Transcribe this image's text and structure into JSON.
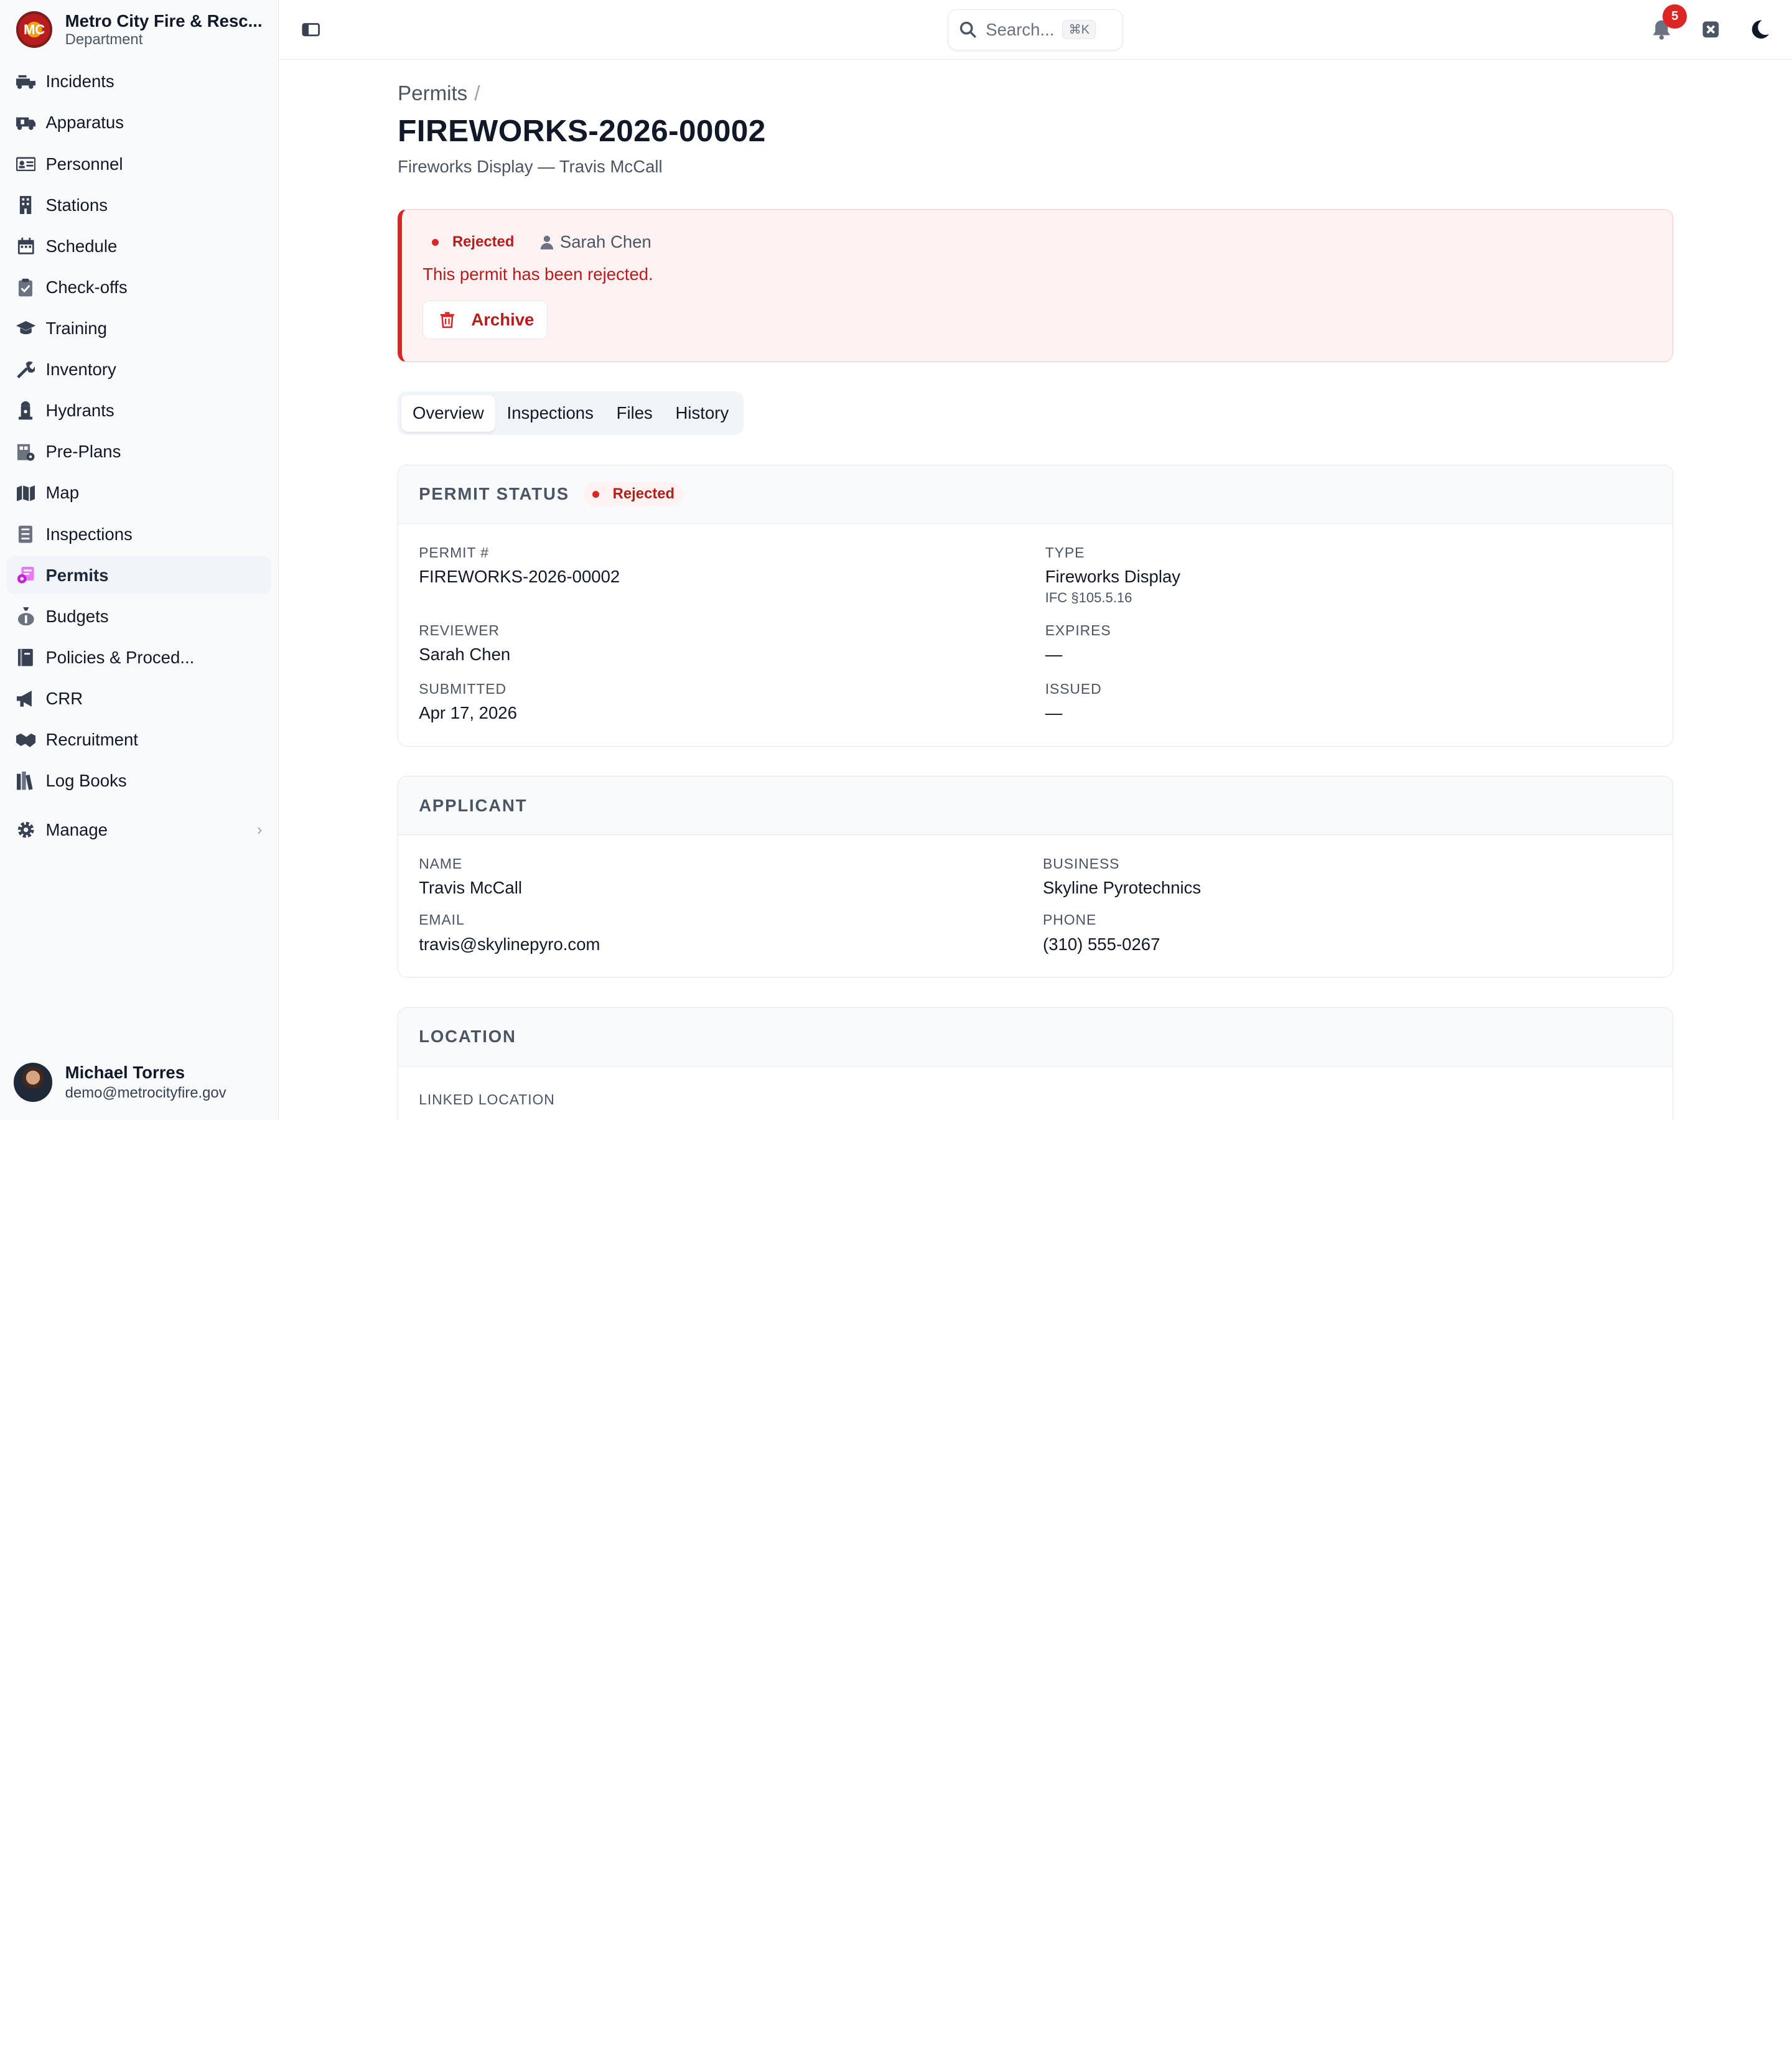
{
  "brand": {
    "name": "Metro City Fire & Resc...",
    "sub": "Department",
    "logo_text": "MC"
  },
  "nav": [
    {
      "label": "Incidents",
      "icon": "fire-truck-icon"
    },
    {
      "label": "Apparatus",
      "icon": "ambulance-icon"
    },
    {
      "label": "Personnel",
      "icon": "id-card-icon"
    },
    {
      "label": "Stations",
      "icon": "building-icon"
    },
    {
      "label": "Schedule",
      "icon": "calendar-icon"
    },
    {
      "label": "Check-offs",
      "icon": "clipboard-icon"
    },
    {
      "label": "Training",
      "icon": "graduation-cap-icon"
    },
    {
      "label": "Inventory",
      "icon": "wrench-icon"
    },
    {
      "label": "Hydrants",
      "icon": "hydrant-icon"
    },
    {
      "label": "Pre-Plans",
      "icon": "blueprint-icon"
    },
    {
      "label": "Map",
      "icon": "map-icon"
    },
    {
      "label": "Inspections",
      "icon": "checklist-icon"
    },
    {
      "label": "Permits",
      "icon": "permit-icon",
      "active": true
    },
    {
      "label": "Budgets",
      "icon": "money-bag-icon"
    },
    {
      "label": "Policies & Proced...",
      "icon": "book-icon"
    },
    {
      "label": "CRR",
      "icon": "megaphone-icon"
    },
    {
      "label": "Recruitment",
      "icon": "handshake-icon"
    },
    {
      "label": "Log Books",
      "icon": "books-icon"
    },
    {
      "label": "Manage",
      "icon": "gear-icon",
      "has_chevron": true
    }
  ],
  "user": {
    "name": "Michael Torres",
    "email": "demo@metrocityfire.gov"
  },
  "topbar": {
    "search_placeholder": "Search...",
    "search_shortcut": "⌘K",
    "notification_count": "5"
  },
  "page": {
    "breadcrumb": "Permits",
    "breadcrumb_sep": "/",
    "title": "FIREWORKS-2026-00002",
    "subtitle": "Fireworks Display — Travis McCall"
  },
  "alert": {
    "status": "Rejected",
    "reviewer": "Sarah Chen",
    "message": "This permit has been rejected.",
    "archive_label": "Archive"
  },
  "tabs": [
    "Overview",
    "Inspections",
    "Files",
    "History"
  ],
  "permit_status": {
    "heading": "PERMIT STATUS",
    "status": "Rejected",
    "permit_label": "PERMIT #",
    "permit_value": "FIREWORKS-2026-00002",
    "type_label": "TYPE",
    "type_value": "Fireworks Display",
    "type_note": "IFC §105.5.16",
    "reviewer_label": "REVIEWER",
    "reviewer_value": "Sarah Chen",
    "expires_label": "EXPIRES",
    "expires_value": "—",
    "submitted_label": "SUBMITTED",
    "submitted_value": "Apr 17, 2026",
    "issued_label": "ISSUED",
    "issued_value": "—"
  },
  "applicant": {
    "heading": "APPLICANT",
    "name_label": "NAME",
    "name_value": "Travis McCall",
    "business_label": "BUSINESS",
    "business_value": "Skyline Pyrotechnics",
    "email_label": "EMAIL",
    "email_value": "travis@skylinepyro.com",
    "phone_label": "PHONE",
    "phone_value": "(310) 555-0267"
  },
  "location": {
    "heading": "LOCATION",
    "linked_label": "LINKED LOCATION"
  },
  "colors": {
    "accent_red": "#dc2626",
    "active_nav_icon": "#c026d3"
  }
}
